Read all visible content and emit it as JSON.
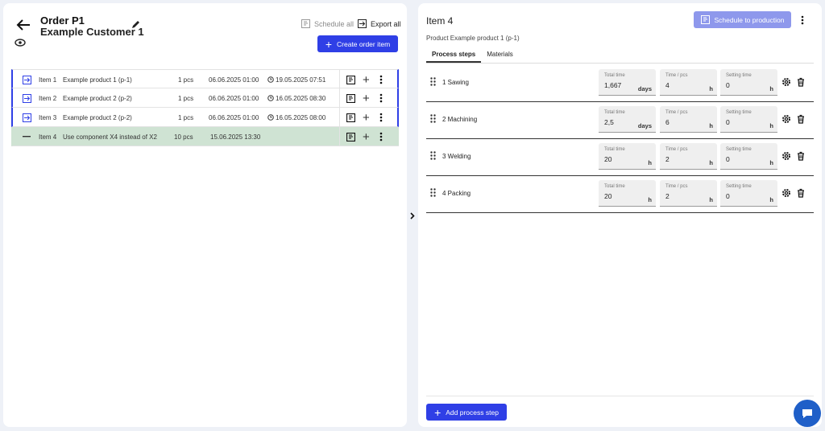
{
  "order": {
    "title": "Order P1",
    "customer": "Example Customer 1",
    "schedule_all_label": "Schedule all",
    "export_all_label": "Export all",
    "create_item_label": "Create order item"
  },
  "items": [
    {
      "name": "Item 1",
      "product": "Example product 1 (p-1)",
      "qty": "1 pcs",
      "due": "06.06.2025 01:00",
      "scheduled": "19.05.2025 07:51",
      "icon": "arrow-into-box-icon"
    },
    {
      "name": "Item 2",
      "product": "Example product 2 (p-2)",
      "qty": "1 pcs",
      "due": "06.06.2025 01:00",
      "scheduled": "16.05.2025 08:30",
      "icon": "arrow-into-box-icon"
    },
    {
      "name": "Item 3",
      "product": "Example product 2 (p-2)",
      "qty": "1 pcs",
      "due": "06.06.2025 01:00",
      "scheduled": "16.05.2025 08:00",
      "icon": "arrow-into-box-icon"
    },
    {
      "name": "Item 4",
      "product": "Use component X4 instead of X2",
      "qty": "10 pcs",
      "due": "15.06.2025 13:30",
      "scheduled": "",
      "icon": "minus-icon"
    }
  ],
  "detail": {
    "title": "Item 4",
    "schedule_label": "Schedule to production",
    "product_label": "Product Example product 1 (p-1)",
    "tabs": [
      "Process steps",
      "Materials"
    ],
    "field_labels": {
      "total": "Total time",
      "per_pcs": "Time / pcs",
      "setting": "Setting time"
    },
    "steps": [
      {
        "name": "1 Sawing",
        "total": "1,667",
        "total_unit": "days",
        "per_pcs": "4",
        "per_pcs_unit": "h",
        "setting": "0",
        "setting_unit": "h"
      },
      {
        "name": "2 Machining",
        "total": "2,5",
        "total_unit": "days",
        "per_pcs": "6",
        "per_pcs_unit": "h",
        "setting": "0",
        "setting_unit": "h"
      },
      {
        "name": "3 Welding",
        "total": "20",
        "total_unit": "h",
        "per_pcs": "2",
        "per_pcs_unit": "h",
        "setting": "0",
        "setting_unit": "h"
      },
      {
        "name": "4 Packing",
        "total": "20",
        "total_unit": "h",
        "per_pcs": "2",
        "per_pcs_unit": "h",
        "setting": "0",
        "setting_unit": "h"
      }
    ],
    "add_step_label": "Add process step"
  },
  "colors": {
    "accent": "#2f3fe6",
    "accent_disabled": "#8e98ec",
    "row_disabled_bg": "#cfe3d3",
    "chat": "#1f5fc8"
  }
}
